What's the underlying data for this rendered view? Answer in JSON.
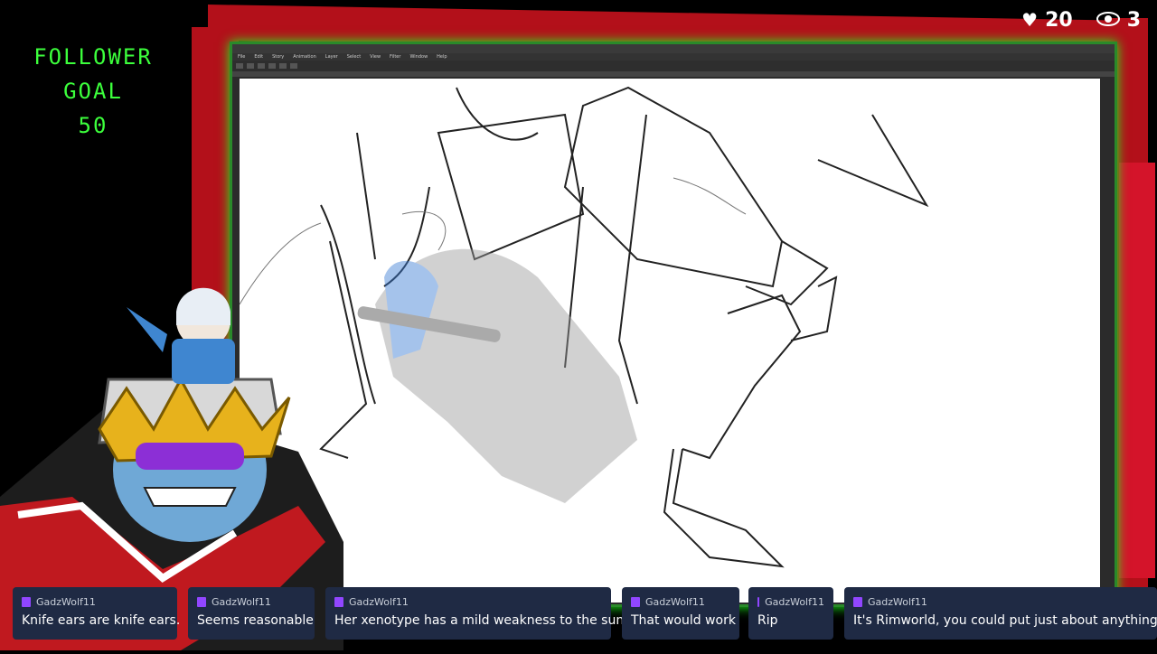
{
  "stream_overlay": {
    "follower_goal": {
      "line1": "FOLLOWER",
      "line2": "GOAL",
      "line3": "50"
    },
    "stats": {
      "likes": "20",
      "viewers": "3",
      "likes_icon": "heart-icon",
      "viewers_icon": "eye-icon"
    }
  },
  "app": {
    "title": "",
    "menu": [
      "File",
      "Edit",
      "Story",
      "Animation",
      "Layer",
      "Select",
      "View",
      "Filter",
      "Window",
      "Help"
    ]
  },
  "chat": {
    "messages": [
      {
        "user": "GadzWolf11",
        "text": "Knife ears are knife ears."
      },
      {
        "user": "GadzWolf11",
        "text": "Seems reasonable"
      },
      {
        "user": "GadzWolf11",
        "text": "Her xenotype has a mild weakness to the sun"
      },
      {
        "user": "GadzWolf11",
        "text": "That would work"
      },
      {
        "user": "GadzWolf11",
        "text": "Rip"
      },
      {
        "user": "GadzWolf11",
        "text": "It's Rimworld, you could put just about anything bel"
      }
    ]
  },
  "colors": {
    "accent_green": "#3cff3c",
    "frame_red": "#b3101a",
    "chat_bg": "#1f2a44",
    "twitch_purple": "#9146ff"
  }
}
